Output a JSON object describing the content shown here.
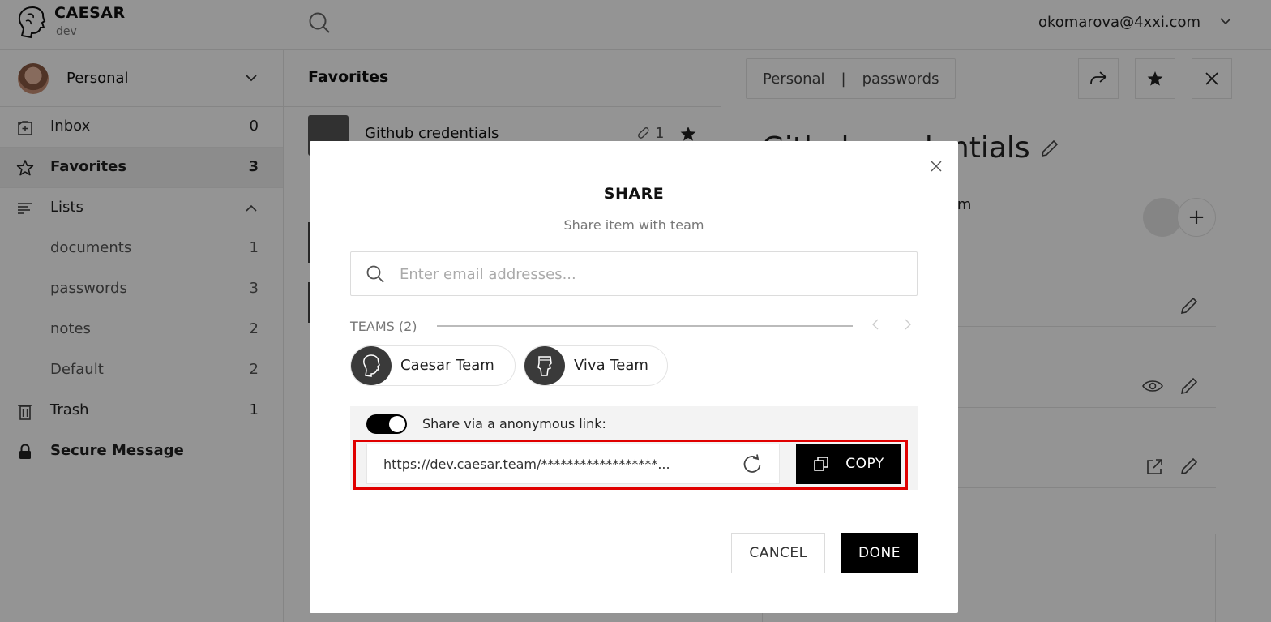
{
  "header": {
    "brand": "CAESAR",
    "env": "dev",
    "account_email": "okomarova@4xxi.com"
  },
  "sidebar": {
    "vault_name": "Personal",
    "items": [
      {
        "label": "Inbox",
        "count": "0",
        "icon": "inbox-icon"
      },
      {
        "label": "Favorites",
        "count": "3",
        "icon": "star-icon"
      },
      {
        "label": "Lists",
        "icon": "lists-icon"
      },
      {
        "label": "documents",
        "count": "1"
      },
      {
        "label": "passwords",
        "count": "3"
      },
      {
        "label": "notes",
        "count": "2"
      },
      {
        "label": "Default",
        "count": "2"
      },
      {
        "label": "Trash",
        "count": "1",
        "icon": "trash-icon"
      },
      {
        "label": "Secure Message",
        "icon": "lock-icon"
      }
    ]
  },
  "list": {
    "title": "Favorites",
    "item": {
      "title": "Github credentials",
      "attachments": "1"
    }
  },
  "detail": {
    "breadcrumb": [
      "Personal",
      "|",
      "passwords"
    ],
    "title": "Github credentials",
    "email_fragment": "com"
  },
  "modal": {
    "title": "SHARE",
    "subtitle": "Share item with team",
    "search_placeholder": "Enter email addresses...",
    "teams_label": "TEAMS (2)",
    "teams": [
      "Caesar Team",
      "Viva Team"
    ],
    "link_toggle_label": "Share via a anonymous link:",
    "link_url": "https://dev.caesar.team/******************...",
    "copy_label": "COPY",
    "cancel_label": "CANCEL",
    "done_label": "DONE"
  },
  "colors": {
    "accent": "#000000",
    "highlight": "#e00000"
  }
}
